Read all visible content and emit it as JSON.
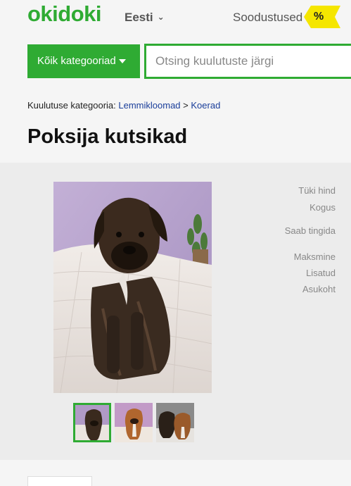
{
  "header": {
    "logo": "okidoki",
    "language": "Eesti",
    "deals_label": "Soodustused",
    "deals_badge": "%"
  },
  "search": {
    "category_button": "Kõik kategooriad",
    "placeholder": "Otsing kuulutuste järgi"
  },
  "breadcrumb": {
    "prefix": "Kuulutuse kategooria:",
    "items": [
      "Lemmikloomad",
      "Koerad"
    ],
    "separator": ">"
  },
  "listing": {
    "title": "Poksija kutsikad",
    "thumbnail_count": 3,
    "properties": [
      "Tüki hind",
      "Kogus",
      "Saab tingida",
      "Maksmine",
      "Lisatud",
      "Asukoht"
    ]
  },
  "colors": {
    "brand_green": "#2fab33",
    "deal_yellow": "#f5e600",
    "link_blue": "#1a3e9a"
  }
}
